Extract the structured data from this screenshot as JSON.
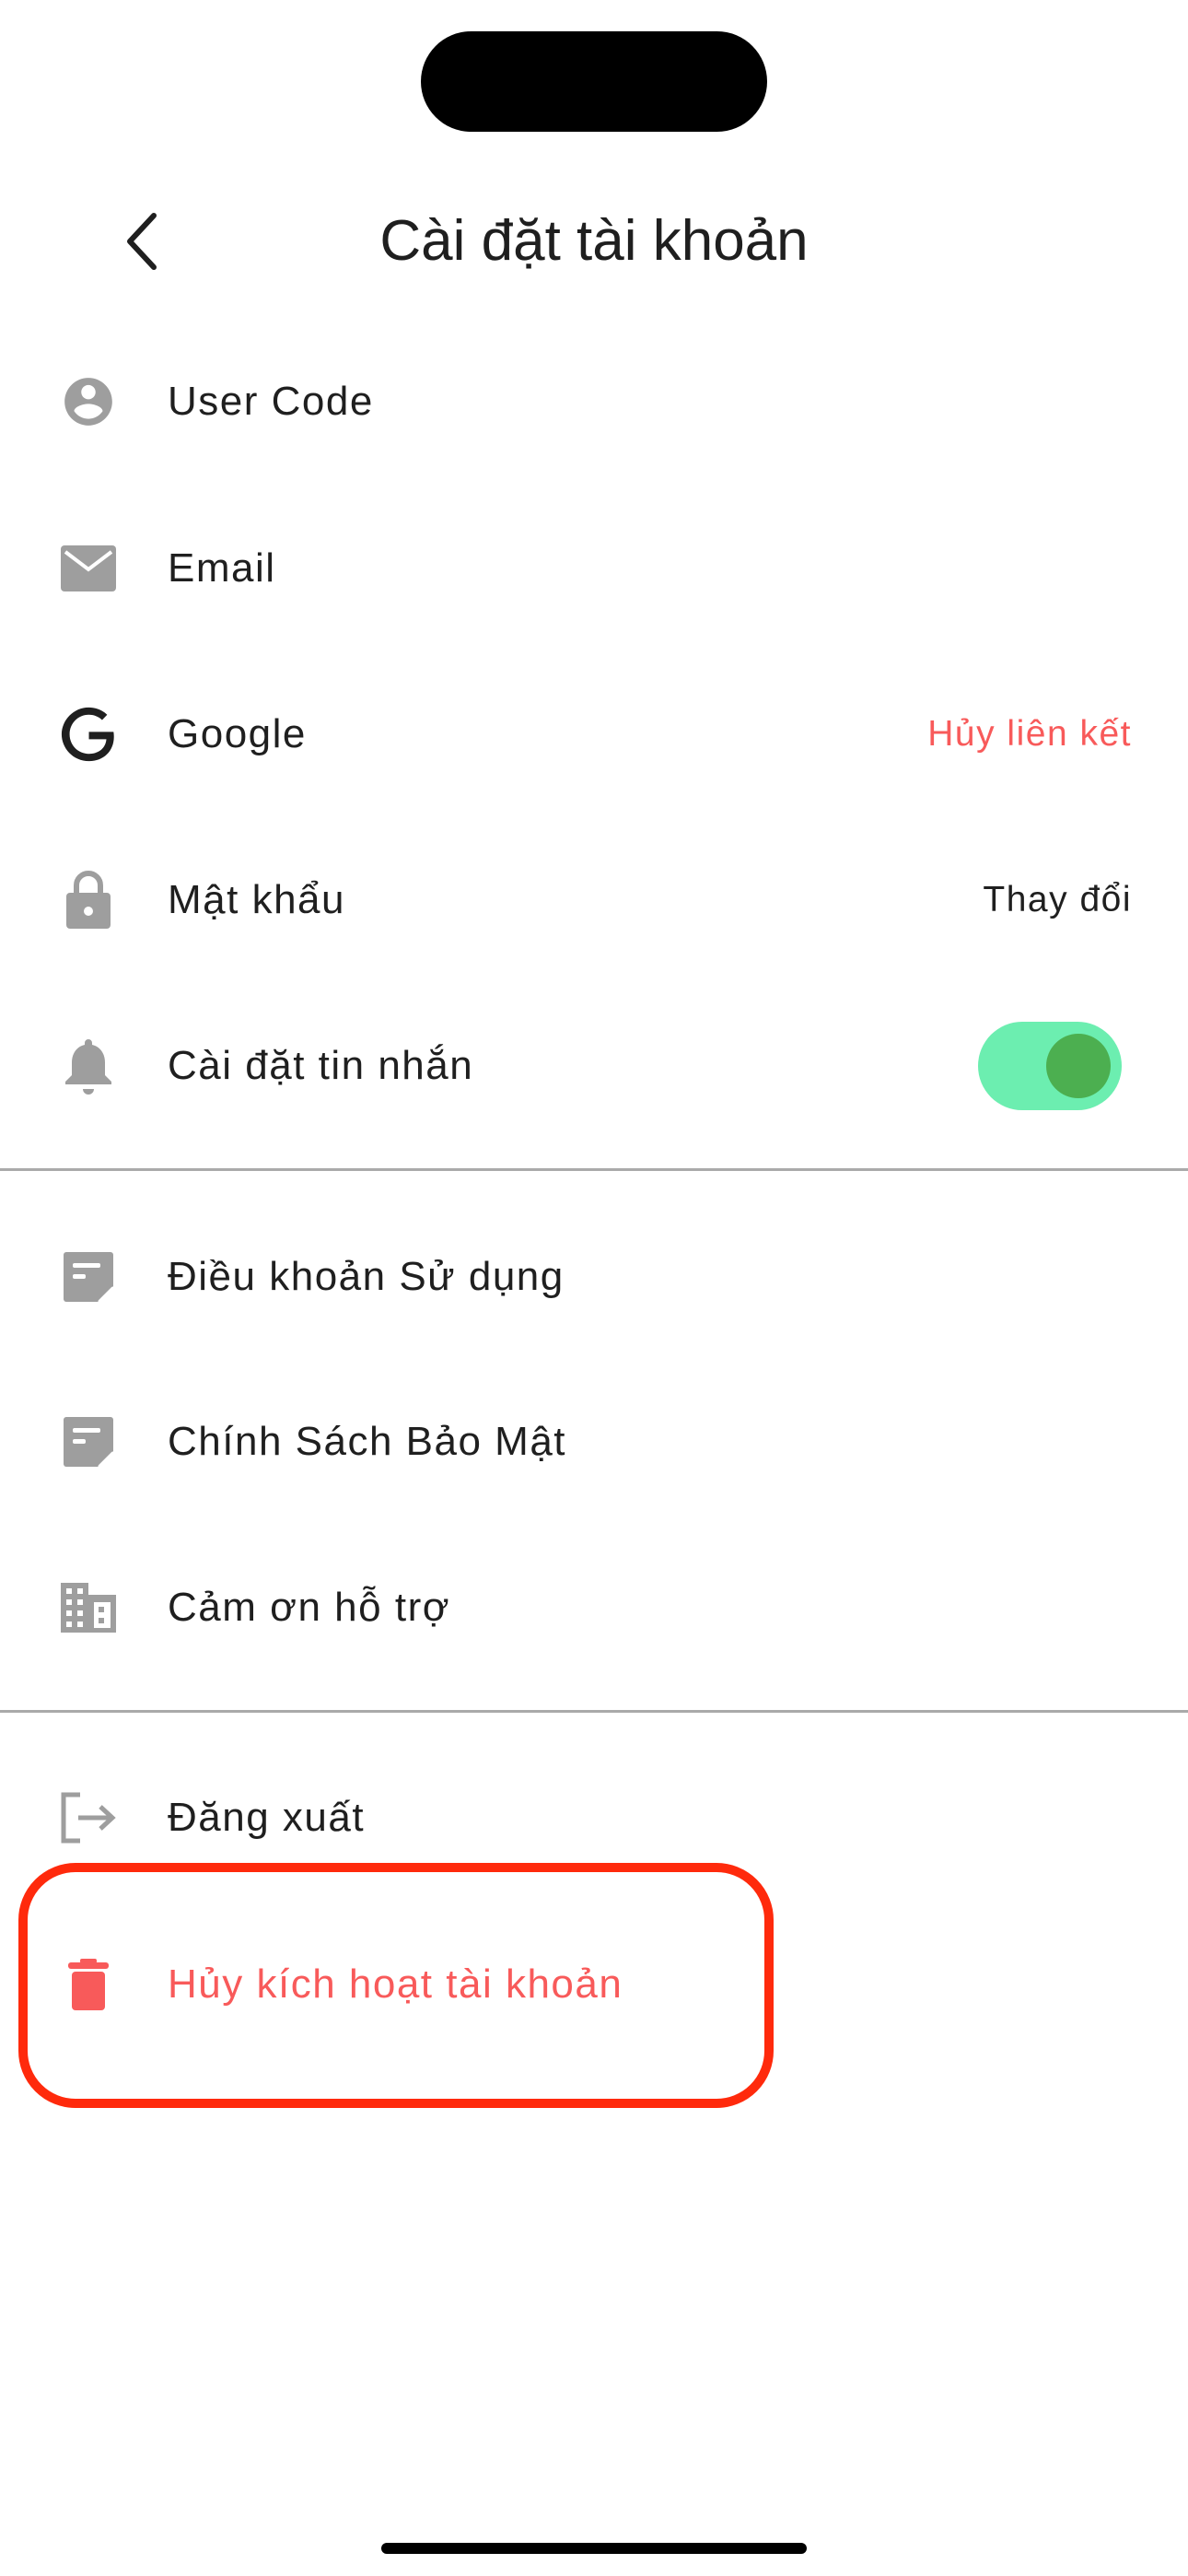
{
  "header": {
    "title": "Cài đặt tài khoản"
  },
  "account_items": [
    {
      "label": "User Code",
      "icon": "account-circle-icon"
    },
    {
      "label": "Email",
      "icon": "email-icon"
    },
    {
      "label": "Google",
      "icon": "google-icon",
      "action": "Hủy liên kết"
    },
    {
      "label": "Mật khẩu",
      "icon": "lock-icon",
      "action": "Thay đổi"
    },
    {
      "label": "Cài đặt tin nhắn",
      "icon": "bell-icon",
      "toggle_on": true
    }
  ],
  "info_items": [
    {
      "label": "Điều khoản Sử dụng",
      "icon": "note-icon"
    },
    {
      "label": "Chính Sách Bảo Mật",
      "icon": "note-icon"
    },
    {
      "label": "Cảm ơn hỗ trợ",
      "icon": "building-icon"
    }
  ],
  "session_items": [
    {
      "label": "Đăng xuất",
      "icon": "logout-icon"
    },
    {
      "label": "Hủy kích hoạt tài khoản",
      "icon": "trash-icon"
    }
  ],
  "colors": {
    "danger": "#f85a5a",
    "toggle_track": "#6ceeb0",
    "toggle_knob": "#4caf50",
    "highlight": "#ff2a0c",
    "icon": "#9e9e9e"
  }
}
